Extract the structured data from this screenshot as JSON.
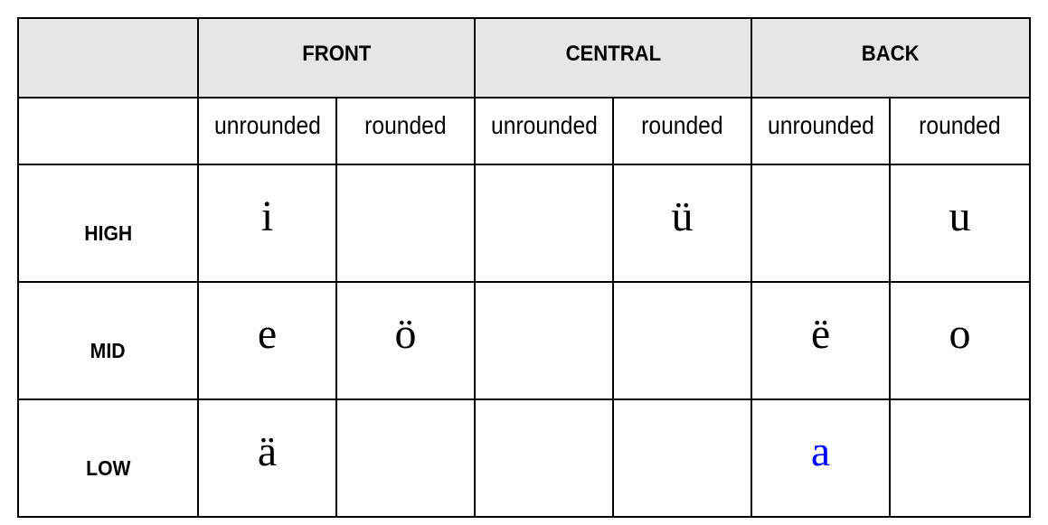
{
  "table": {
    "groups": [
      "FRONT",
      "CENTRAL",
      "BACK"
    ],
    "subheaders": [
      "unrounded",
      "rounded",
      "unrounded",
      "rounded",
      "unrounded",
      "rounded"
    ],
    "rows": [
      {
        "label": "HIGH",
        "cells": [
          "i",
          "",
          "",
          "ü",
          "",
          "u"
        ]
      },
      {
        "label": "MID",
        "cells": [
          "e",
          "ö",
          "",
          "",
          "ë",
          "o"
        ]
      },
      {
        "label": "LOW",
        "cells": [
          "ä",
          "",
          "",
          "",
          "a",
          ""
        ]
      }
    ],
    "highlight": {
      "vowel": "a",
      "color": "#0000ff"
    }
  }
}
